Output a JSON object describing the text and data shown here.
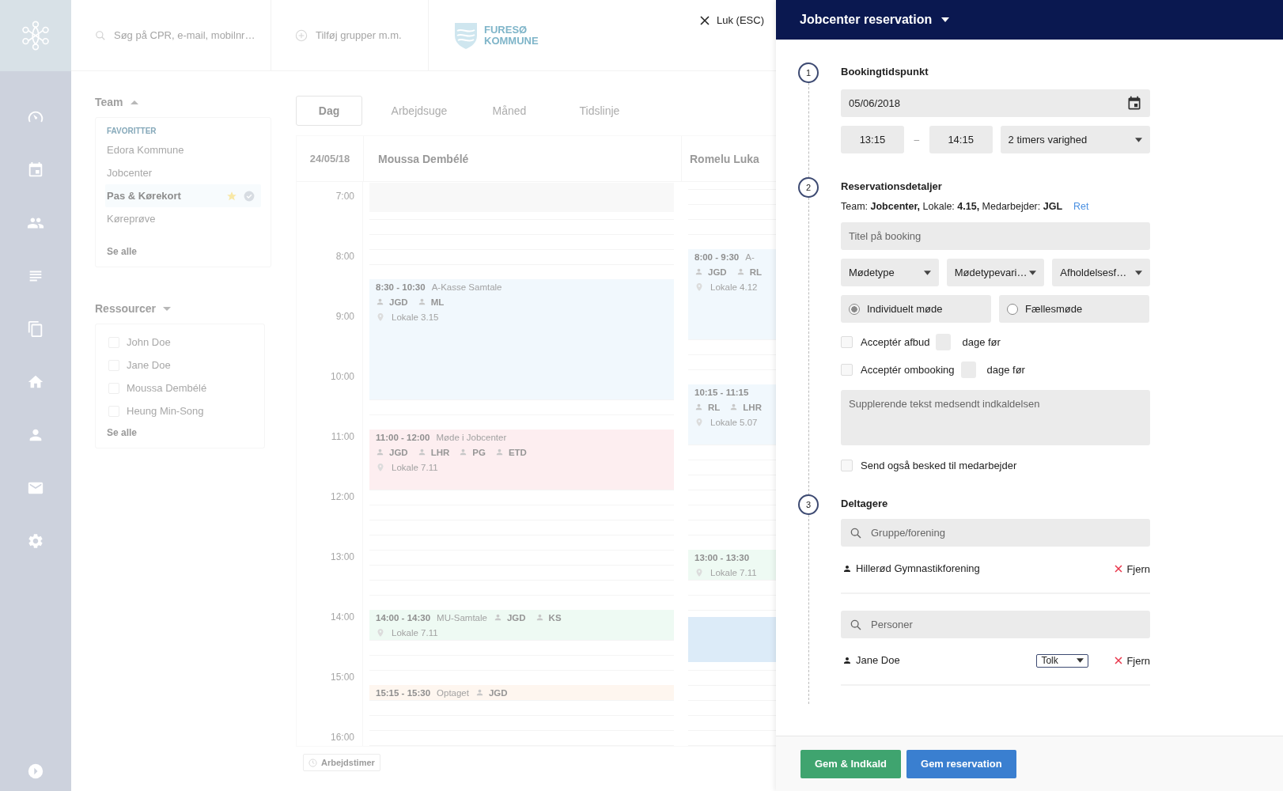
{
  "header": {
    "search": {
      "placeholder": "Søg på CPR, e-mail, mobilnr…"
    },
    "add_groups": {
      "label": "Tilføj grupper m.m."
    },
    "logo": {
      "line_1": "FURESØ",
      "line_2": "KOMMUNE"
    },
    "close": {
      "label": "Luk (ESC)"
    }
  },
  "team": {
    "title": "Team",
    "section": "FAVORITTER",
    "see_all": "Se alle",
    "items": [
      {
        "label": "Edora Kommune",
        "selected": false
      },
      {
        "label": "Jobcenter",
        "selected": false
      },
      {
        "label": "Pas & Kørekort",
        "selected": true
      },
      {
        "label": "Køreprøve",
        "selected": false
      }
    ]
  },
  "resources": {
    "title": "Ressourcer",
    "see_all": "Se alle",
    "items": [
      {
        "label": "John Doe",
        "checked": false
      },
      {
        "label": "Jane Doe",
        "checked": false
      },
      {
        "label": "Moussa Dembélé",
        "checked": false
      },
      {
        "label": "Heung Min-Song",
        "checked": false
      }
    ]
  },
  "calendar": {
    "tabs": [
      {
        "label": "Dag",
        "selected": true
      },
      {
        "label": "Arbejdsuge",
        "selected": false
      },
      {
        "label": "Måned",
        "selected": false
      },
      {
        "label": "Tidslinje",
        "selected": false
      }
    ],
    "date": "24/05/18",
    "hours": [
      "7:00",
      "8:00",
      "9:00",
      "10:00",
      "11:00",
      "12:00",
      "13:00",
      "14:00",
      "15:00",
      "16:00"
    ],
    "columns": [
      {
        "name": "Moussa Dembélé",
        "events": [
          {
            "time": "8:30 - 10:30",
            "title": "A-Kasse Samtale",
            "persons": [
              "JGD",
              "ML"
            ],
            "location": "Lokale 3.15",
            "color": "#f1f8fd"
          },
          {
            "time": "11:00 - 12:00",
            "title": "Møde i Jobcenter",
            "persons": [
              "JGD",
              "LHR",
              "PG",
              "ETD"
            ],
            "location": "Lokale 7.11",
            "color": "#fdeef0"
          },
          {
            "time": "14:00 - 14:30",
            "title": "MU-Samtale",
            "persons": [
              "JGD",
              "KS"
            ],
            "location": "Lokale 7.11",
            "color": "#eefaf3"
          },
          {
            "time": "15:15 - 15:30",
            "title": "Optaget",
            "persons": [
              "JGD"
            ],
            "color": "#fef6ef"
          }
        ]
      },
      {
        "name": "Romelu Luka",
        "events": [
          {
            "time": "8:00 - 9:30",
            "title": "A-",
            "persons": [
              "JGD",
              "RL"
            ],
            "location": "Lokale 4.12",
            "color": "#f1f8fd"
          },
          {
            "time": "10:15 - 11:15",
            "persons": [
              "RL",
              "LHR"
            ],
            "location": "Lokale 5.07",
            "color": "#f1f8fd"
          },
          {
            "time": "13:00 - 13:30",
            "location": "Lokale 7.11",
            "color": "#eefaf3"
          }
        ]
      }
    ],
    "working_hours": "Arbejdstimer"
  },
  "panel": {
    "title": "Jobcenter reservation",
    "booking_time": {
      "number": "1",
      "title": "Bookingtidspunkt",
      "date": "05/06/2018",
      "start": "13:15",
      "separator": "–",
      "end": "14:15",
      "duration": "2 timers varighed"
    },
    "details": {
      "number": "2",
      "title": "Reservationsdetaljer",
      "summary": "Team: **Jobcenter,** Lokale: **4.15,** Medarbejder: **JGL**",
      "edit_link": "Ret",
      "title_field": {
        "placeholder": "Titel på booking"
      },
      "selects": [
        "Mødetype",
        "Mødetypevari…",
        "Afholdelsesf…"
      ],
      "meeting_types": [
        {
          "label": "Individuelt møde",
          "selected": true
        },
        {
          "label": "Fællesmøde",
          "selected": false
        }
      ],
      "options": [
        {
          "label": "Acceptér afbud",
          "checked": false,
          "suffix": "dage før"
        },
        {
          "label": "Acceptér ombooking",
          "checked": false,
          "suffix": "dage før"
        }
      ],
      "message": {
        "placeholder": "Supplerende tekst medsendt indkaldelsen"
      },
      "notify": {
        "label": "Send også besked til medarbejder",
        "checked": false
      }
    },
    "participants": {
      "number": "3",
      "title": "Deltagere",
      "groups": {
        "placeholder": "Gruppe/forening",
        "items": [
          {
            "name": "Hillerød Gymnastikforening",
            "remove": "Fjern"
          }
        ]
      },
      "persons": {
        "placeholder": "Personer",
        "items": [
          {
            "name": "Jane Doe",
            "role": "Tolk",
            "remove": "Fjern"
          }
        ]
      }
    },
    "buttons": [
      {
        "label": "Gem & Indkald",
        "kind": "secondary"
      },
      {
        "label": "Gem reservation",
        "kind": "primary"
      }
    ]
  }
}
